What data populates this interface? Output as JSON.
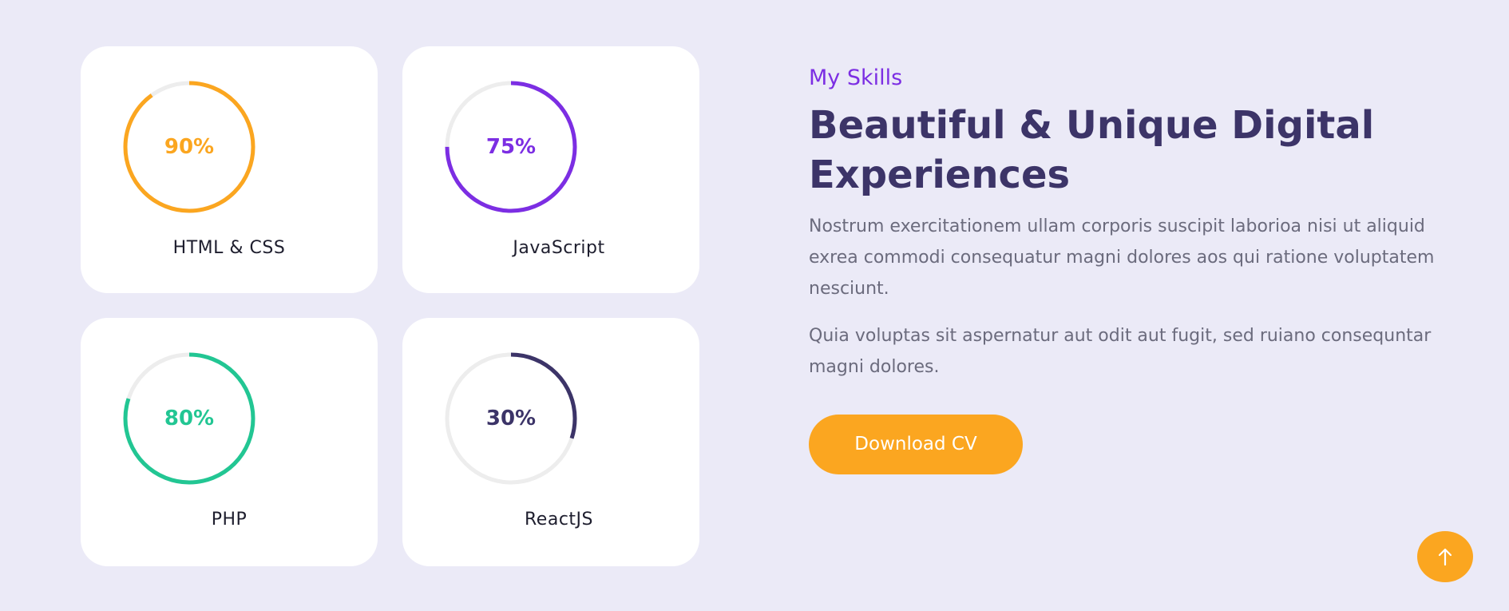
{
  "skills": [
    {
      "name": "HTML & CSS",
      "percent": 90,
      "percent_label": "90%",
      "color": "#fba620"
    },
    {
      "name": "JavaScript",
      "percent": 75,
      "percent_label": "75%",
      "color": "#7c2ee3"
    },
    {
      "name": "PHP",
      "percent": 80,
      "percent_label": "80%",
      "color": "#22c693"
    },
    {
      "name": "ReactJS",
      "percent": 30,
      "percent_label": "30%",
      "color": "#3c3468"
    }
  ],
  "track_color": "#ededed",
  "about": {
    "eyebrow": "My Skills",
    "headline_line1": "Beautiful & Unique Digital",
    "headline_line2": "Experiences",
    "paragraph1": "Nostrum exercitationem ullam corporis suscipit laborioa nisi ut aliquid exrea commodi consequatur magni dolores aos qui ratione voluptatem nesciunt.",
    "paragraph2": "Quia voluptas sit aspernatur aut odit aut fugit, sed ruiano consequntar magni dolores."
  },
  "download_button": {
    "label": "Download CV",
    "color": "#fba620"
  },
  "scroll_top_button": {
    "icon": "arrow-up-icon",
    "color": "#fba620"
  }
}
